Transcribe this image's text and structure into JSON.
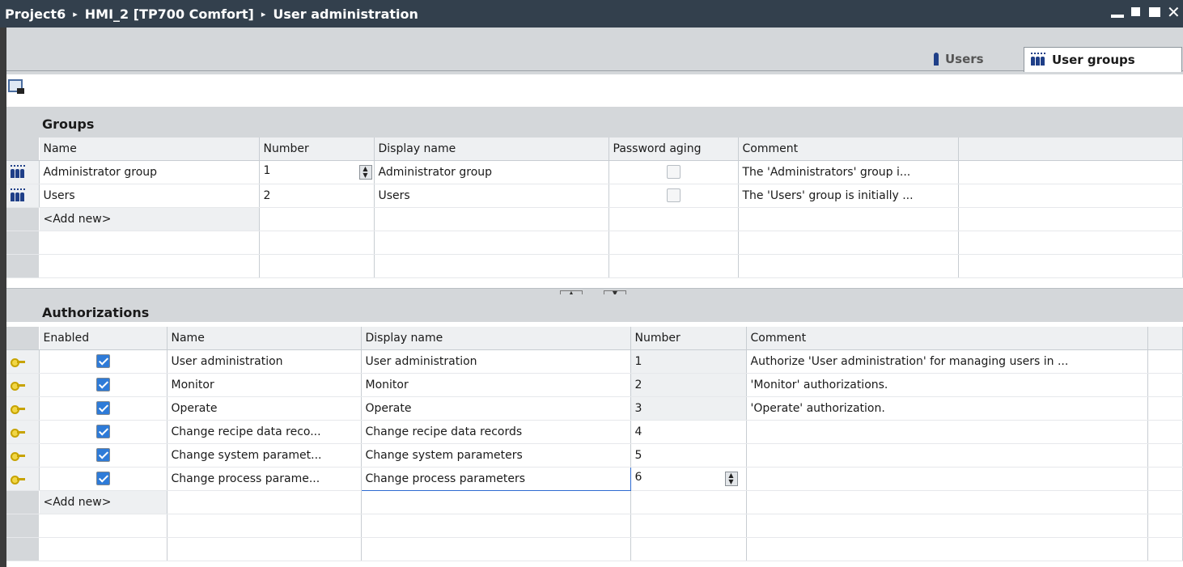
{
  "titlebar": {
    "crumbs": [
      "Project6",
      "HMI_2 [TP700 Comfort]",
      "User administration"
    ],
    "separator": "▸"
  },
  "tabs": [
    {
      "label": "Users",
      "icon": "user-icon",
      "active": false
    },
    {
      "label": "User groups",
      "icon": "user-group-icon",
      "active": true
    }
  ],
  "groups": {
    "title": "Groups",
    "columns": [
      "Name",
      "Number",
      "Display name",
      "Password aging",
      "Comment"
    ],
    "rows": [
      {
        "name": "Administrator group",
        "number": "1",
        "display_name": "Administrator group",
        "password_aging": false,
        "comment": "The 'Administrators' group i..."
      },
      {
        "name": "Users",
        "number": "2",
        "display_name": "Users",
        "password_aging": false,
        "comment": "The 'Users' group is initially ..."
      }
    ],
    "add_new": "<Add new>"
  },
  "authorizations": {
    "title": "Authorizations",
    "columns": [
      "Enabled",
      "Name",
      "Display name",
      "Number",
      "Comment"
    ],
    "rows": [
      {
        "enabled": true,
        "name": "User administration",
        "display_name": "User administration",
        "number": "1",
        "comment": "Authorize 'User administration' for managing users in ..."
      },
      {
        "enabled": true,
        "name": "Monitor",
        "display_name": "Monitor",
        "number": "2",
        "comment": "'Monitor' authorizations."
      },
      {
        "enabled": true,
        "name": "Operate",
        "display_name": "Operate",
        "number": "3",
        "comment": "'Operate' authorization."
      },
      {
        "enabled": true,
        "name": "Change recipe data reco...",
        "display_name": "Change recipe data records",
        "number": "4",
        "comment": ""
      },
      {
        "enabled": true,
        "name": "Change system paramet...",
        "display_name": "Change system parameters",
        "number": "5",
        "comment": ""
      },
      {
        "enabled": true,
        "name": "Change process parame...",
        "display_name": "Change process parameters",
        "number": "6",
        "comment": ""
      }
    ],
    "add_new": "<Add new>"
  },
  "colors": {
    "titlebar": "#33404d",
    "panel": "#d4d7da",
    "accent": "#2e7bd8"
  }
}
